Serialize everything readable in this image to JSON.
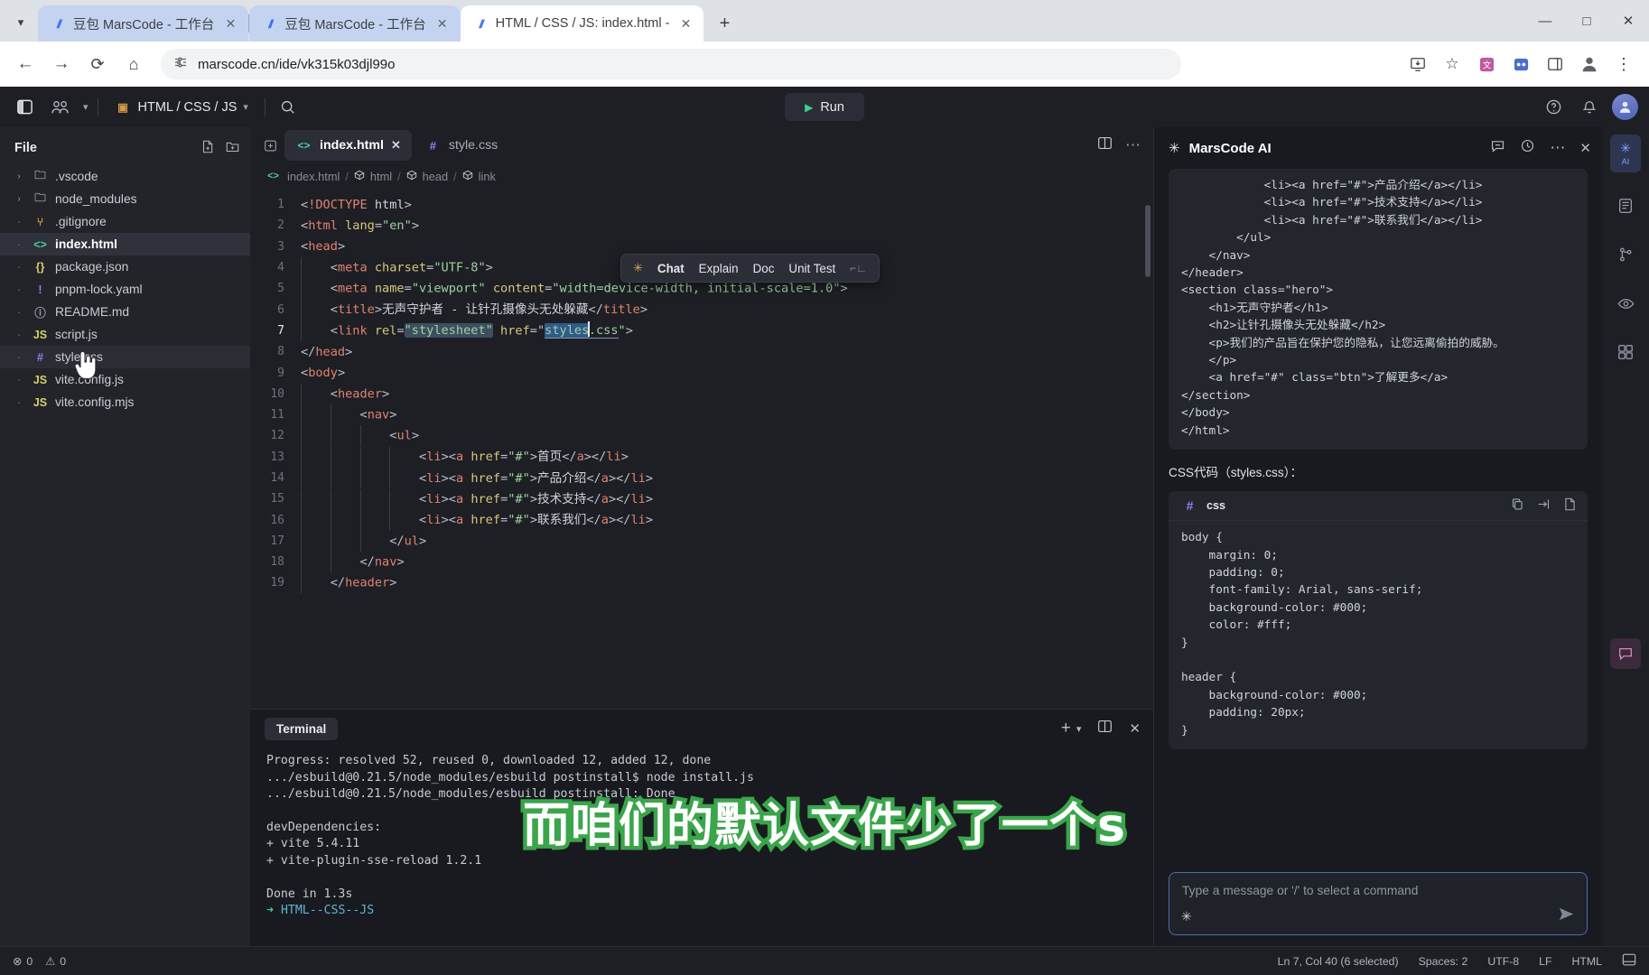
{
  "browser": {
    "tabs": [
      {
        "title": "豆包 MarsCode - 工作台",
        "active": false
      },
      {
        "title": "豆包 MarsCode - 工作台",
        "active": false
      },
      {
        "title": "HTML / CSS / JS: index.html -",
        "active": true
      }
    ],
    "new_tab_label": "+",
    "url": "marscode.cn/ide/vk315k03djl99o",
    "nav": {
      "back": "←",
      "forward": "→",
      "reload": "⟳",
      "home": "⌂"
    },
    "window_controls": {
      "minimize": "—",
      "maximize": "□",
      "close": "✕"
    }
  },
  "ide": {
    "topbar": {
      "project_name": "HTML / CSS / JS",
      "run_label": "Run"
    },
    "explorer": {
      "title": "File",
      "items": [
        {
          "name": ".vscode",
          "icon": "folder-icon",
          "glyph": "🗀",
          "kind": "folder",
          "state": "normal"
        },
        {
          "name": "node_modules",
          "icon": "folder-icon",
          "glyph": "🗀",
          "kind": "folder",
          "state": "normal"
        },
        {
          "name": ".gitignore",
          "icon": "git-icon",
          "glyph": "⑂",
          "kind": "file",
          "state": "normal"
        },
        {
          "name": "index.html",
          "icon": "html-icon",
          "glyph": "<>",
          "kind": "file",
          "state": "selected"
        },
        {
          "name": "package.json",
          "icon": "json-icon",
          "glyph": "{}",
          "kind": "file",
          "state": "normal"
        },
        {
          "name": "pnpm-lock.yaml",
          "icon": "yaml-icon",
          "glyph": "!",
          "kind": "file",
          "state": "normal"
        },
        {
          "name": "README.md",
          "icon": "markdown-icon",
          "glyph": "⓪",
          "kind": "file",
          "state": "normal"
        },
        {
          "name": "script.js",
          "icon": "js-icon",
          "glyph": "JS",
          "kind": "file",
          "state": "normal"
        },
        {
          "name": "style.css",
          "icon": "css-icon",
          "glyph": "#",
          "kind": "file",
          "state": "hover"
        },
        {
          "name": "vite.config.js",
          "icon": "js-icon",
          "glyph": "JS",
          "kind": "file",
          "state": "normal"
        },
        {
          "name": "vite.config.mjs",
          "icon": "js-icon",
          "glyph": "JS",
          "kind": "file",
          "state": "normal"
        }
      ]
    },
    "editor": {
      "tabs": [
        {
          "label": "index.html",
          "icon": "html-icon",
          "glyph": "<>",
          "active": true,
          "closable": true
        },
        {
          "label": "style.css",
          "icon": "css-icon",
          "glyph": "#",
          "active": false,
          "closable": false
        }
      ],
      "breadcrumb": [
        "index.html",
        "html",
        "head",
        "link"
      ],
      "lines": [
        {
          "n": 1,
          "indent": 0
        },
        {
          "n": 2,
          "indent": 0
        },
        {
          "n": 3,
          "indent": 0
        },
        {
          "n": 4,
          "indent": 1
        },
        {
          "n": 5,
          "indent": 1
        },
        {
          "n": 6,
          "indent": 1
        },
        {
          "n": 7,
          "indent": 1
        },
        {
          "n": 8,
          "indent": 0
        },
        {
          "n": 9,
          "indent": 0
        },
        {
          "n": 10,
          "indent": 1
        },
        {
          "n": 11,
          "indent": 2
        },
        {
          "n": 12,
          "indent": 3
        },
        {
          "n": 13,
          "indent": 4
        },
        {
          "n": 14,
          "indent": 4
        },
        {
          "n": 15,
          "indent": 4
        },
        {
          "n": 16,
          "indent": 4
        },
        {
          "n": 17,
          "indent": 3
        },
        {
          "n": 18,
          "indent": 2
        },
        {
          "n": 19,
          "indent": 1
        }
      ],
      "code_text": {
        "l1": "<!DOCTYPE html>",
        "l2": "<html lang=\"en\">",
        "l3": "<head>",
        "l4": "<meta charset=\"UTF-8\">",
        "l5": "<meta name=\"viewport\" content=\"width=device-width, initial-scale=1.0\">",
        "l6": "<title>无声守护者 - 让针孔摄像头无处躲藏</title>",
        "l7": "<link rel=\"stylesheet\" href=\"styles.css\">",
        "l8": "</head>",
        "l9": "<body>",
        "l10": "<header>",
        "l11": "<nav>",
        "l12": "<ul>",
        "l13": "<li><a href=\"#\">首页</a></li>",
        "l14": "<li><a href=\"#\">产品介绍</a></li>",
        "l15": "<li><a href=\"#\">技术支持</a></li>",
        "l16": "<li><a href=\"#\">联系我们</a></li>",
        "l17": "</ul>",
        "l18": "</nav>",
        "l19": "</header>"
      },
      "ai_popup": {
        "chat": "Chat",
        "explain": "Explain",
        "doc": "Doc",
        "unit_test": "Unit Test",
        "shortcut_hint": "⌐∟"
      }
    },
    "terminal": {
      "tab_label": "Terminal",
      "add_label": "+",
      "output": [
        "Progress: resolved 52, reused 0, downloaded 12, added 12, done",
        ".../esbuild@0.21.5/node_modules/esbuild postinstall$ node install.js",
        ".../esbuild@0.21.5/node_modules/esbuild postinstall: Done",
        "",
        "devDependencies:",
        "+ vite 5.4.11",
        "+ vite-plugin-sse-reload 1.2.1",
        "",
        "Done in 1.3s"
      ],
      "prompt_symbol": "➜",
      "prompt_path": "HTML--CSS--JS"
    },
    "ai_panel": {
      "title": "MarsCode AI",
      "html_snippet": "            <li><a href=\"#\">产品介绍</a></li>\n            <li><a href=\"#\">技术支持</a></li>\n            <li><a href=\"#\">联系我们</a></li>\n        </ul>\n    </nav>\n</header>\n<section class=\"hero\">\n    <h1>无声守护者</h1>\n    <h2>让针孔摄像头无处躲藏</h2>\n    <p>我们的产品旨在保护您的隐私，让您远离偷拍的威胁。\n    </p>\n    <a href=\"#\" class=\"btn\">了解更多</a>\n</section>\n</body>\n</html>",
      "css_label": "CSS代码（styles.css）：",
      "css_block_lang": "css",
      "css_snippet": "body {\n    margin: 0;\n    padding: 0;\n    font-family: Arial, sans-serif;\n    background-color: #000;\n    color: #fff;\n}\n\nheader {\n    background-color: #000;\n    padding: 20px;\n}",
      "input_placeholder": "Type a message or '/' to select a command"
    },
    "statusbar": {
      "errors": "0",
      "warnings": "0",
      "cursor_position": "Ln 7, Col 40 (6 selected)",
      "indentation": "Spaces: 2",
      "encoding": "UTF-8",
      "line_ending": "LF",
      "language": "HTML"
    }
  },
  "overlay": {
    "subtitle": "而咱们的默认文件少了一个s",
    "subtitle_fill": "#ffffff",
    "subtitle_stroke": "#3aa54a"
  }
}
